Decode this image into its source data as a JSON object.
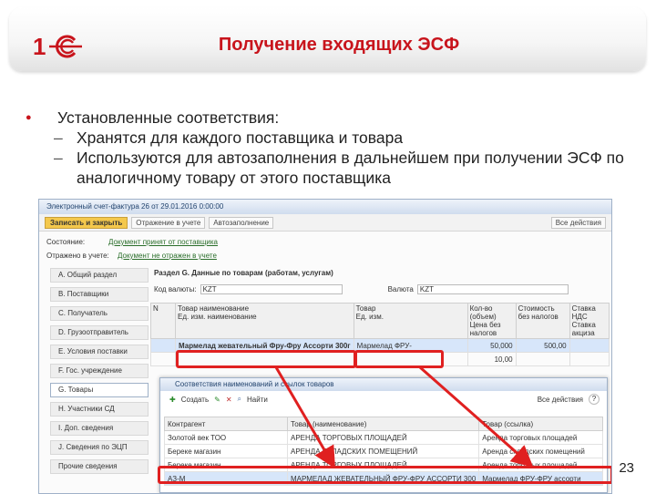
{
  "slide": {
    "title": "Получение входящих ЭСФ",
    "bullet": "Установленные соответствия:",
    "sub_items": [
      "Хранятся для каждого поставщика и товара",
      "Используются для автозаполнения в дальнейшем при получении ЭСФ по аналогичному товару от этого поставщика"
    ],
    "page_number": "23"
  },
  "colors": {
    "title_red": "#c8141c",
    "highlight": "#e02020",
    "selection": "#d7e6fa"
  },
  "window": {
    "title": "Электронный счет-фактура 26 от 29.01.2016 0:00:00",
    "toolbar": {
      "save": "Записать и закрыть",
      "reflect": "Отражение в учете",
      "autofill": "Автозаполнение",
      "more": "Все действия"
    },
    "status_label": "Состояние:",
    "status_value": "Документ принят от поставщика",
    "accounting_label": "Отражено в учете:",
    "accounting_value": "Документ не отражен в учете",
    "nav": [
      "A. Общий раздел",
      "B. Поставщики",
      "C. Получатель",
      "D. Грузоотправитель",
      "E. Условия поставки",
      "F. Гос. учреждение",
      "G. Товары",
      "H. Участники СД",
      "I. Доп. сведения",
      "J. Сведения по ЭЦП",
      "Прочие сведения"
    ],
    "active_nav_index": 6,
    "section_title": "Раздел G. Данные по товарам (работам, услугам)",
    "currency_code_label": "Код валюты:",
    "currency_code_value": "KZT",
    "currency_label": "Валюта",
    "currency_value": "KZT",
    "columns": [
      "N",
      "Товар наименование",
      "Товар",
      "Кол-во (объем)",
      "Стоимость без налогов",
      "Ставка НДС"
    ],
    "columns_row2": [
      "",
      "Ед. изм. наименование",
      "Ед. изм.",
      "Цена без налогов",
      "",
      "Ставка акциза"
    ],
    "row": {
      "name": "Мармелад жевательный Фру-Фру Ассорти 300г",
      "item": "Мармелад ФРУ-",
      "qty": "50,000",
      "cost": "500,00",
      "price": "10,00"
    }
  },
  "dialog": {
    "title": "Соответствия наименований и ссылок товаров",
    "create": "Создать",
    "find": "Найти",
    "actions": "Все действия",
    "help": "?",
    "columns": [
      "Контрагент",
      "Товар (наименование)",
      "Товар (ссылка)"
    ],
    "rows": [
      {
        "contractor": "Золотой век ТОО",
        "name": "АРЕНДА ТОРГОВЫХ ПЛОЩАДЕЙ",
        "link": "Аренда торговых площадей"
      },
      {
        "contractor": "Береке магазин",
        "name": "АРЕНДА СКЛАДСКИХ ПОМЕЩЕНИЙ",
        "link": "Аренда складских помещений"
      },
      {
        "contractor": "Береке магазин",
        "name": "АРЕНДА ТОРГОВЫХ ПЛОЩАДЕЙ",
        "link": "Аренда торговых площадей"
      },
      {
        "contractor": "АЗ-М",
        "name": "МАРМЕЛАД ЖЕВАТЕЛЬНЫЙ ФРУ-ФРУ АССОРТИ 300",
        "link": "Мармелад ФРУ-ФРУ ассорти"
      }
    ],
    "selected_row_index": 3
  }
}
